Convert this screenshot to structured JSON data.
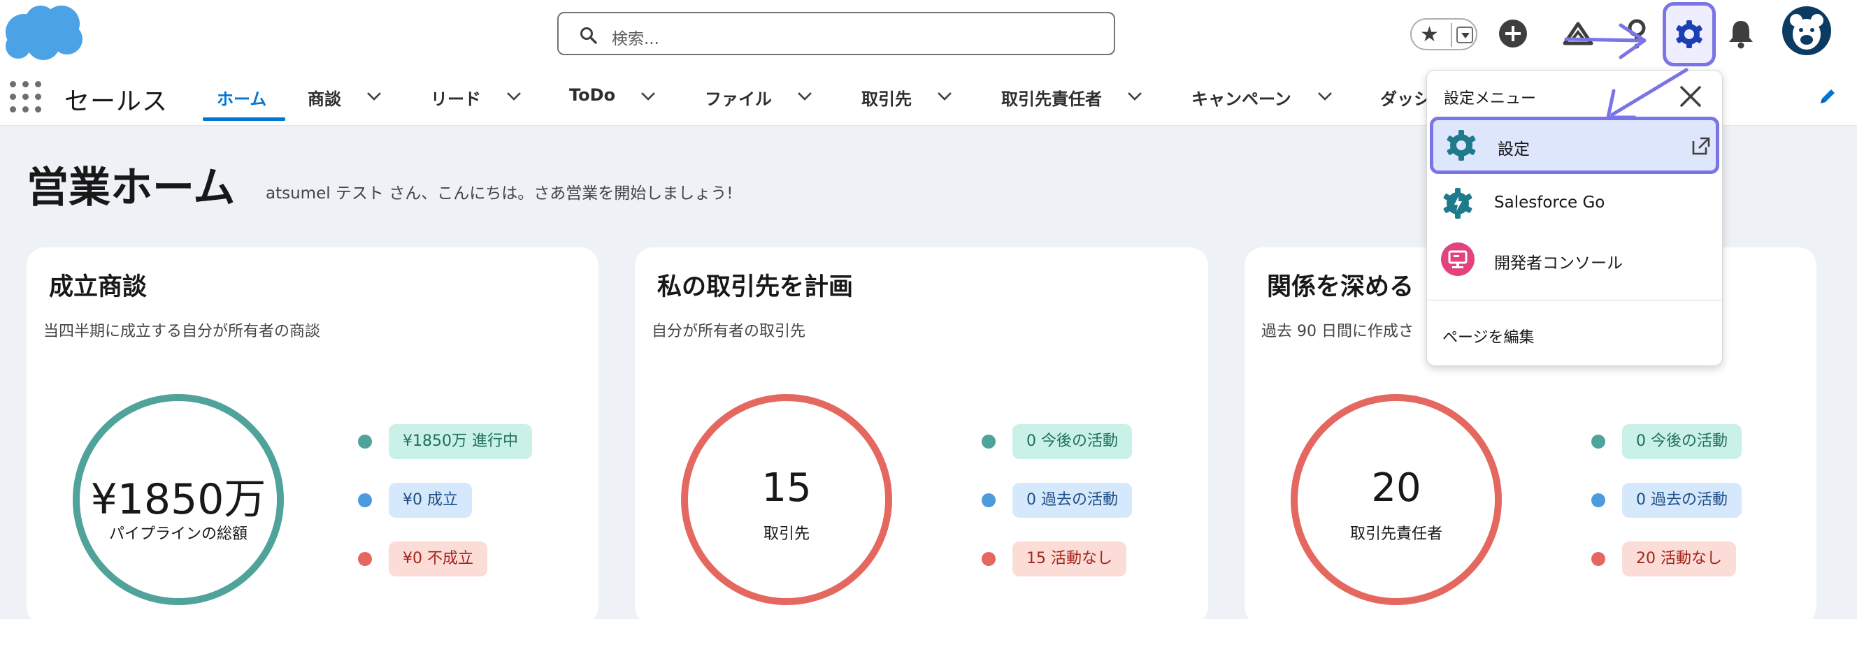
{
  "header": {
    "search_placeholder": "検索...",
    "icons": [
      "salesforce-cloud-logo",
      "search-icon",
      "favorites-star-icon",
      "favorites-dropdown-icon",
      "global-create-icon",
      "trailhead-icon",
      "help-icon",
      "setup-gear-icon",
      "notifications-bell-icon",
      "user-avatar"
    ],
    "brand_color": "#0176d3",
    "highlight_color": "#7a74e6"
  },
  "nav": {
    "app_name": "セールス",
    "tabs": [
      {
        "label": "ホーム",
        "active": true
      },
      {
        "label": "商談"
      },
      {
        "label": "リード"
      },
      {
        "label": "ToDo"
      },
      {
        "label": "ファイル"
      },
      {
        "label": "取引先"
      },
      {
        "label": "取引先責任者"
      },
      {
        "label": "キャンペーン"
      },
      {
        "label": "ダッシ"
      }
    ]
  },
  "page": {
    "title": "営業ホーム",
    "greeting": "atsumel テスト さん、こんにちは。さあ営業を開始しましょう!"
  },
  "cards": [
    {
      "title": "成立商談",
      "subtitle": "当四半期に成立する自分が所有者の商談",
      "ring_value": "¥1850万",
      "ring_label": "パイプラインの総額",
      "legend": [
        "¥1850万 進行中",
        "¥0 成立",
        "¥0 不成立"
      ]
    },
    {
      "title": "私の取引先を計画",
      "subtitle": "自分が所有者の取引先",
      "ring_value": "15",
      "ring_label": "取引先",
      "legend": [
        "0 今後の活動",
        "0 過去の活動",
        "15 活動なし"
      ]
    },
    {
      "title": "関係を深める",
      "subtitle": "過去 90 日間に作成さ",
      "ring_value": "20",
      "ring_label": "取引先責任者",
      "legend": [
        "0 今後の活動",
        "0 過去の活動",
        "20 活動なし"
      ]
    }
  ],
  "setup_menu": {
    "title": "設定メニュー",
    "items": [
      {
        "label": "設定",
        "icon": "setup-gear-icon",
        "highlighted": true
      },
      {
        "label": "Salesforce Go",
        "icon": "salesforce-go-icon"
      },
      {
        "label": "開発者コンソール",
        "icon": "developer-console-icon"
      }
    ],
    "footer": "ページを編集"
  }
}
